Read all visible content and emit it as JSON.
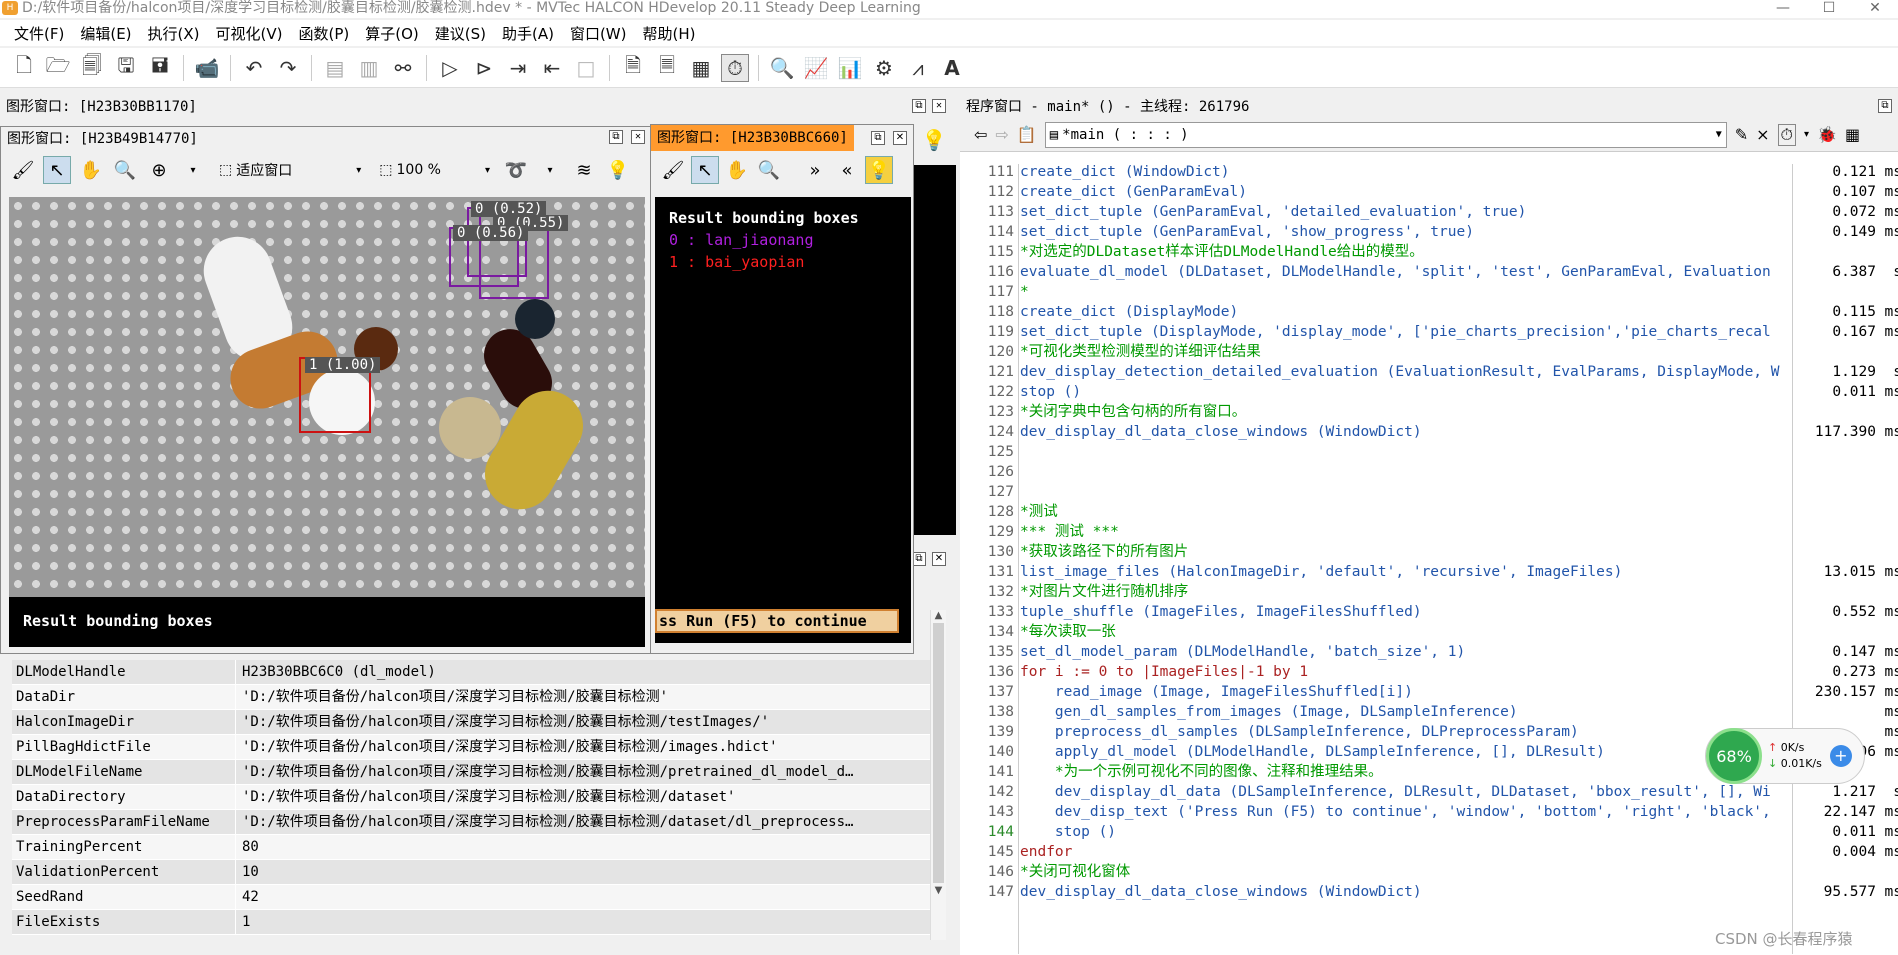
{
  "app": {
    "title": "D:/软件项目备份/halcon项目/深度学习目标检测/胶囊目标检测/胶囊检测.hdev * - MVTec HALCON HDevelop 20.11 Steady Deep Learning",
    "logo": "H"
  },
  "window_controls": {
    "minimize": "—",
    "maximize": "☐",
    "close": "✕"
  },
  "menu": [
    "文件(F)",
    "编辑(E)",
    "执行(X)",
    "可视化(V)",
    "函数(P)",
    "算子(O)",
    "建议(S)",
    "助手(A)",
    "窗口(W)",
    "帮助(H)"
  ],
  "graphics_outer": {
    "title": "图形窗口: [H23B30BB1170]"
  },
  "graphics_main": {
    "title": "图形窗口: [H23B49B14770]",
    "fit_label": "适应窗口",
    "zoom_label": "100 %",
    "result_text": "Result bounding boxes",
    "box_labels": [
      "0 (0.52)",
      "0 (0.56)",
      "0 (0.55)",
      "1 (1.00)"
    ]
  },
  "graphics_legend": {
    "title": "图形窗口: [H23B30BBC660]",
    "heading": "Result bounding boxes",
    "class0": "0 : lan_jiaonang",
    "class1": "1 : bai_yaopian",
    "continue": "ss Run (F5) to continue"
  },
  "variables": [
    {
      "name": "DLModelHandle",
      "value": "H23B30BBC6C0 (dl_model)"
    },
    {
      "name": "DataDir",
      "value": "'D:/软件项目备份/halcon项目/深度学习目标检测/胶囊目标检测'"
    },
    {
      "name": "HalconImageDir",
      "value": "'D:/软件项目备份/halcon项目/深度学习目标检测/胶囊目标检测/testImages/'"
    },
    {
      "name": "PillBagHdictFile",
      "value": "'D:/软件项目备份/halcon项目/深度学习目标检测/胶囊目标检测/images.hdict'"
    },
    {
      "name": "DLModelFileName",
      "value": "'D:/软件项目备份/halcon项目/深度学习目标检测/胶囊目标检测/pretrained_dl_model_d…"
    },
    {
      "name": "DataDirectory",
      "value": "'D:/软件项目备份/halcon项目/深度学习目标检测/胶囊目标检测/dataset'"
    },
    {
      "name": "PreprocessParamFileName",
      "value": "'D:/软件项目备份/halcon项目/深度学习目标检测/胶囊目标检测/dataset/dl_preprocess…"
    },
    {
      "name": "TrainingPercent",
      "value": "80"
    },
    {
      "name": "ValidationPercent",
      "value": "10"
    },
    {
      "name": "SeedRand",
      "value": "42"
    },
    {
      "name": "FileExists",
      "value": "1"
    }
  ],
  "program": {
    "title": "程序窗口 - main* () - 主线程: 261796",
    "proc_select": "*main ( : : : )",
    "lines": [
      {
        "n": "111",
        "t": "create_dict (WindowDict)",
        "k": "op",
        "time": "0.121",
        "u": "ms"
      },
      {
        "n": "112",
        "t": "create_dict (GenParamEval)",
        "k": "op",
        "time": "0.107",
        "u": "ms"
      },
      {
        "n": "113",
        "t": "set_dict_tuple (GenParamEval, 'detailed_evaluation', true)",
        "k": "op",
        "time": "0.072",
        "u": "ms"
      },
      {
        "n": "114",
        "t": "set_dict_tuple (GenParamEval, 'show_progress', true)",
        "k": "op",
        "time": "0.149",
        "u": "ms"
      },
      {
        "n": "115",
        "t": "*对选定的DLDataset样本评估DLModelHandle给出的模型。",
        "k": "cm",
        "time": "",
        "u": ""
      },
      {
        "n": "116",
        "t": "evaluate_dl_model (DLDataset, DLModelHandle, 'split', 'test', GenParamEval, Evaluation",
        "k": "op",
        "time": "6.387",
        "u": "s"
      },
      {
        "n": "117",
        "t": "*",
        "k": "cm",
        "time": "",
        "u": ""
      },
      {
        "n": "118",
        "t": "create_dict (DisplayMode)",
        "k": "op",
        "time": "0.115",
        "u": "ms"
      },
      {
        "n": "119",
        "t": "set_dict_tuple (DisplayMode, 'display_mode', ['pie_charts_precision','pie_charts_recal",
        "k": "op",
        "time": "0.167",
        "u": "ms"
      },
      {
        "n": "120",
        "t": "*可视化类型检测模型的详细评估结果",
        "k": "cm",
        "time": "",
        "u": ""
      },
      {
        "n": "121",
        "t": "dev_display_detection_detailed_evaluation (EvaluationResult, EvalParams, DisplayMode, W",
        "k": "op",
        "time": "1.129",
        "u": "s"
      },
      {
        "n": "122",
        "t": "stop ()",
        "k": "op",
        "time": "0.011",
        "u": "ms"
      },
      {
        "n": "123",
        "t": "*关闭字典中包含句柄的所有窗口。",
        "k": "cm",
        "time": "",
        "u": ""
      },
      {
        "n": "124",
        "t": "dev_display_dl_data_close_windows (WindowDict)",
        "k": "op",
        "time": "117.390",
        "u": "ms"
      },
      {
        "n": "125",
        "t": "",
        "k": "op",
        "time": "",
        "u": ""
      },
      {
        "n": "126",
        "t": "",
        "k": "op",
        "time": "",
        "u": ""
      },
      {
        "n": "127",
        "t": "",
        "k": "op",
        "time": "",
        "u": ""
      },
      {
        "n": "128",
        "t": "*测试",
        "k": "cm",
        "time": "",
        "u": ""
      },
      {
        "n": "129",
        "t": "*** 测试 ***",
        "k": "cm",
        "time": "",
        "u": ""
      },
      {
        "n": "130",
        "t": "*获取该路径下的所有图片",
        "k": "cm",
        "time": "",
        "u": ""
      },
      {
        "n": "131",
        "t": "list_image_files (HalconImageDir, 'default', 'recursive', ImageFiles)",
        "k": "op",
        "time": "13.015",
        "u": "ms"
      },
      {
        "n": "132",
        "t": "*对图片文件进行随机排序",
        "k": "cm",
        "time": "",
        "u": ""
      },
      {
        "n": "133",
        "t": "tuple_shuffle (ImageFiles, ImageFilesShuffled)",
        "k": "op",
        "time": "0.552",
        "u": "ms"
      },
      {
        "n": "134",
        "t": "*每次读取一张",
        "k": "cm",
        "time": "",
        "u": ""
      },
      {
        "n": "135",
        "t": "set_dl_model_param (DLModelHandle, 'batch_size', 1)",
        "k": "op",
        "time": "0.147",
        "u": "ms"
      },
      {
        "n": "136",
        "t": "for i := 0 to |ImageFiles|-1 by 1",
        "k": "kw",
        "time": "0.273",
        "u": "ms"
      },
      {
        "n": "137",
        "t": "    read_image (Image, ImageFilesShuffled[i])",
        "k": "op",
        "time": "230.157",
        "u": "ms"
      },
      {
        "n": "138",
        "t": "    gen_dl_samples_from_images (Image, DLSampleInference)",
        "k": "op",
        "time": "",
        "u": "ms"
      },
      {
        "n": "139",
        "t": "    preprocess_dl_samples (DLSampleInference, DLPreprocessParam)",
        "k": "op",
        "time": "",
        "u": "ms"
      },
      {
        "n": "140",
        "t": "    apply_dl_model (DLModelHandle, DLSampleInference, [], DLResult)",
        "k": "op",
        "time": "605.306",
        "u": "ms"
      },
      {
        "n": "141",
        "t": "    *为一个示例可视化不同的图像、注释和推理结果。",
        "k": "cm",
        "time": "",
        "u": ""
      },
      {
        "n": "142",
        "t": "    dev_display_dl_data (DLSampleInference, DLResult, DLDataset, 'bbox_result', [], Wi",
        "k": "op",
        "time": "1.217",
        "u": "s"
      },
      {
        "n": "143",
        "t": "    dev_disp_text ('Press Run (F5) to continue', 'window', 'bottom', 'right', 'black',",
        "k": "op",
        "time": "22.147",
        "u": "ms"
      },
      {
        "n": "144",
        "t": "    stop ()",
        "k": "op",
        "time": "0.011",
        "u": "ms"
      },
      {
        "n": "145",
        "t": "endfor",
        "k": "kw",
        "time": "0.004",
        "u": "ms"
      },
      {
        "n": "146",
        "t": "*关闭可视化窗体",
        "k": "cm",
        "time": "",
        "u": ""
      },
      {
        "n": "147",
        "t": "dev_display_dl_data_close_windows (WindowDict)",
        "k": "op",
        "time": "95.577",
        "u": "ms"
      }
    ]
  },
  "netmon": {
    "percent": "68%",
    "up": "0K/s",
    "down": "0.01K/s"
  },
  "watermark": "CSDN @长春程序猿"
}
